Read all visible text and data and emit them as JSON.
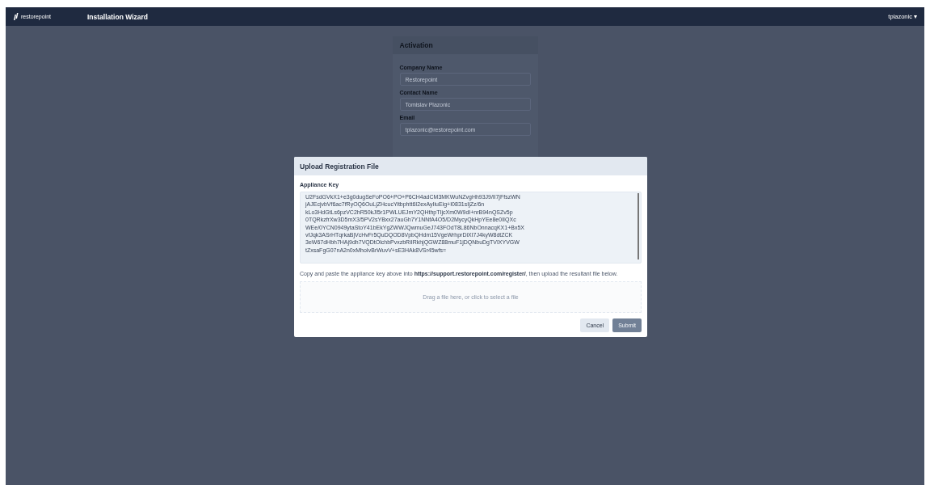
{
  "top_bar": {
    "logo": "restorepoint",
    "title": "Installation Wizard",
    "user": "tplazonic",
    "user_caret": "▾"
  },
  "background_card": {
    "title": "Activation",
    "fields": [
      {
        "label": "Company Name",
        "value": "Restorepoint"
      },
      {
        "label": "Contact Name",
        "value": "Tomislav Plazonic"
      },
      {
        "label": "Email",
        "value": "tplazonic@restorepoint.com"
      }
    ]
  },
  "dialog": {
    "title": "Upload Registration File",
    "key_label": "Appliance Key",
    "key_lines": [
      "U2FsdGVkX1+e3g0dugSeFoPO6+PO+P6CH4adCM3MKWuNZvgHh93J9/lI7jFfszWN",
      "jAJEcjvbVf6ac7fRyOQ6OuLjZHcucYitbphtt6I2exAyIiuEig+I0831sIjZz/6n",
      "kLo3HdGtLs6pzVC2hR50kJl5r1PWLUEJmY2QHthpTIjcXm0W9dI+nrB94nQSZv5p",
      "0TQRkzfrXw3D5mX3/5PV2sYBxx27auGh7Y1NNfA4O5/D2MycyQkHpYEe8e0IIQXc",
      "WEe/0YCN0949ytaStoY41bEkYgZWWJQwmuGeJ743FOdT8L86NbOnnacqKX1+Bx5X",
      "vfJqk3ASrHTqrkaBjVcHvFr5QuDQOD8VpbQHdm15VgeWrhprDiXI7J4kyW8dtZCK",
      "3eW67dHbh7HAj9dh7VQDtOlchbPvxzbRiIRkhjQGWZ88muF1jDQNbuDgTVIXYVGW",
      "tZxsaFgG07nA2n0xMhoIvBrWuvV+sE3HAk8VSr45wfs="
    ],
    "instruction_before": "Copy and paste the appliance key above into",
    "link": "https://support.restorepoint.com/register/",
    "instruction_after": ", then upload the resultant file below.",
    "dropzone": {
      "placeholder": "Drag a file here, or click to select a file"
    },
    "buttons": [
      {
        "label": "Cancel",
        "kind": "secondary",
        "disabled": false
      },
      {
        "label": "Submit",
        "kind": "primary",
        "disabled": true
      }
    ]
  }
}
